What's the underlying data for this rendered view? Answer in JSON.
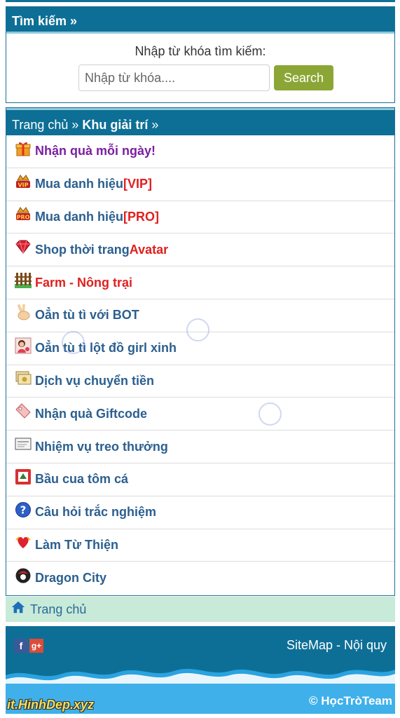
{
  "search": {
    "header": "Tìm kiếm »",
    "label": "Nhập từ khóa tìm kiếm:",
    "placeholder": "Nhập từ khóa....",
    "button": "Search"
  },
  "menu": {
    "breadcrumb_home": "Trang chủ »",
    "breadcrumb_current": "Khu giải trí",
    "breadcrumb_sep": " »",
    "items": [
      {
        "icon": "gift-icon",
        "label": "Nhận quà mỗi ngày!",
        "suffix": ""
      },
      {
        "icon": "vip-badge-icon",
        "label": "Mua danh hiệu ",
        "suffix": "[VIP]"
      },
      {
        "icon": "pro-badge-icon",
        "label": "Mua danh hiệu ",
        "suffix": "[PRO]"
      },
      {
        "icon": "ruby-icon",
        "label": "Shop thời trang ",
        "suffix": "Avatar"
      },
      {
        "icon": "fence-icon",
        "label": "Farm - Nông trại",
        "suffix": ""
      },
      {
        "icon": "peace-hand-icon",
        "label": "Oẳn tù tì với BOT",
        "suffix": ""
      },
      {
        "icon": "girl-avatar-icon",
        "label": "Oẳn tù tì lột đồ girl xinh",
        "suffix": ""
      },
      {
        "icon": "money-transfer-icon",
        "label": "Dịch vụ chuyển tiền",
        "suffix": ""
      },
      {
        "icon": "tag-icon",
        "label": "Nhận quà Giftcode",
        "suffix": ""
      },
      {
        "icon": "card-icon",
        "label": "Nhiệm vụ treo thưởng",
        "suffix": ""
      },
      {
        "icon": "dice-icon",
        "label": "Bầu cua tôm cá",
        "suffix": ""
      },
      {
        "icon": "question-icon",
        "label": "Câu hỏi trắc nghiệm",
        "suffix": ""
      },
      {
        "icon": "heart-icon",
        "label": "Làm Từ Thiện",
        "suffix": ""
      },
      {
        "icon": "dragon-icon",
        "label": "Dragon City",
        "suffix": ""
      }
    ]
  },
  "home_bar": {
    "icon": "home-icon",
    "label": "Trang chủ"
  },
  "footer": {
    "links": "SiteMap - Nội quy",
    "copyright": "© HọcTròTeam",
    "watermark": "it.HinhDep.xyz",
    "social": [
      "f",
      "g+"
    ]
  },
  "colors": {
    "header_blue": "#0e6f96",
    "button_green": "#8ca636",
    "link_blue": "#2b5f8f",
    "purple": "#7b1fa2",
    "red": "#e02020",
    "home_bar_bg": "#c8ead8"
  }
}
